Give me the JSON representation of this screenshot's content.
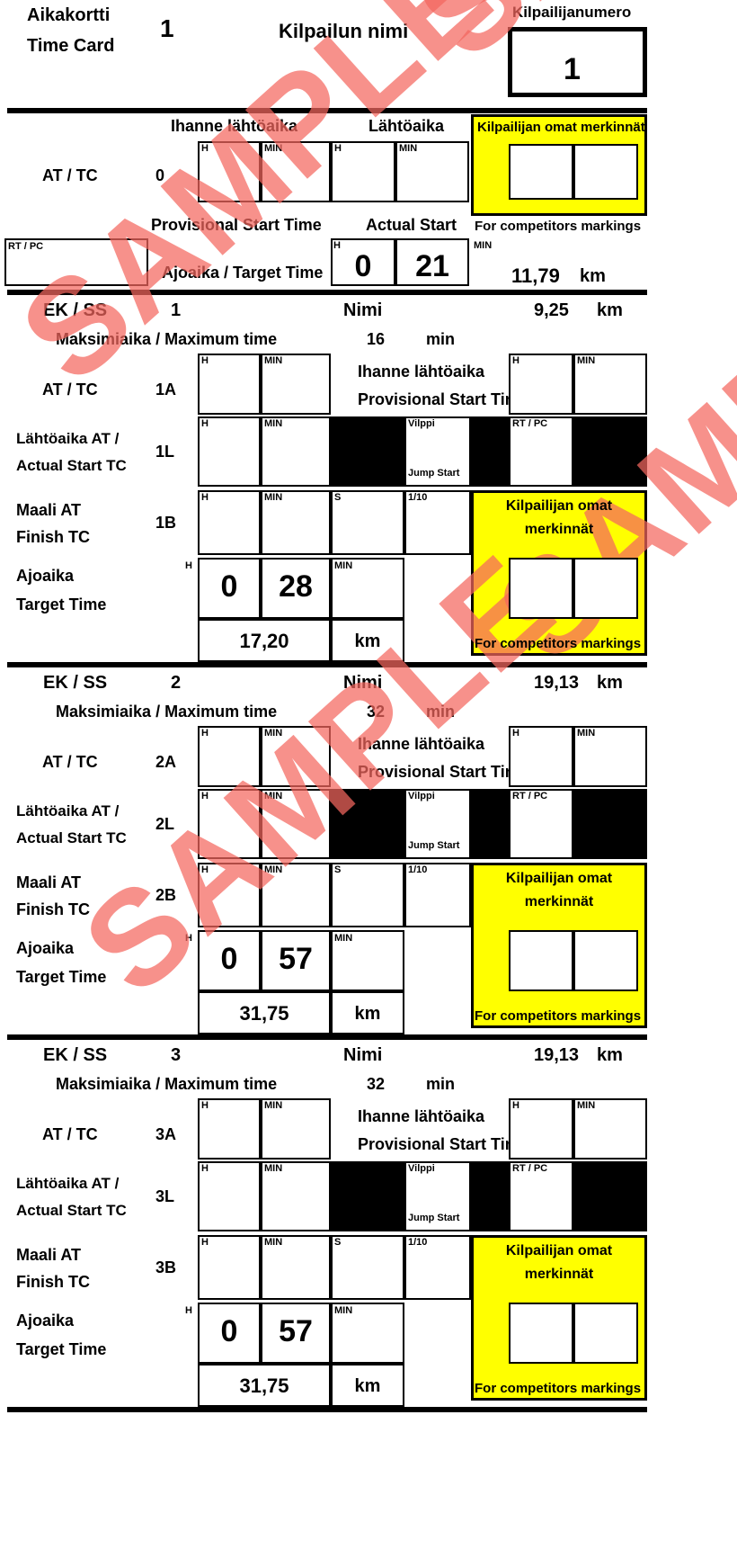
{
  "document": {
    "title_fi": "Aikakortti",
    "title_en": "Time Card",
    "card_number": "1",
    "event_name_label": "Kilpailun nimi",
    "competitor_number_label": "Kilpailijanumero",
    "competitor_number": "1",
    "watermark": "SAMPLE"
  },
  "labels": {
    "at_tc": "AT / TC",
    "ihanne_lahtoaika": "Ihanne lähtöaika",
    "provisional_start_time": "Provisional Start Time",
    "lahtoaika": "Lähtöaika",
    "actual_start": "Actual Start",
    "kilpailijan_omat_merkinnat": "Kilpailijan omat merkinnät",
    "kilpailijan_omat": "Kilpailijan omat",
    "merkinnat": "merkinnät",
    "for_competitors_markings": "For competitors markings",
    "rt_pc": "RT / PC",
    "ajoaika_target_time": "Ajoaika / Target Time",
    "ajoaika": "Ajoaika",
    "target_time": "Target Time",
    "ek_ss": "EK / SS",
    "nimi": "Nimi",
    "maksimiaika": "Maksimiaika / Maximum time",
    "min": "min",
    "km": "km",
    "h": "H",
    "minute": "MIN",
    "s": "S",
    "tenth": "1/10",
    "vilppi": "Vilppi",
    "jump_start": "Jump Start",
    "lahtoaika_at": "Lähtöaika AT /",
    "actual_start_tc": "Actual Start TC",
    "maali_at": "Maali AT",
    "finish_tc": "Finish TC"
  },
  "header_section": {
    "at_tc_code": "0",
    "target_time_h": "0",
    "target_time_min": "21",
    "distance": "11,79",
    "distance_unit": "km"
  },
  "stages": [
    {
      "number": "1",
      "stage_distance": "9,25",
      "stage_distance_unit": "km",
      "max_time": "16",
      "max_time_unit": "min",
      "at_code": "1A",
      "start_code": "1L",
      "finish_code": "1B",
      "target_time_h": "0",
      "target_time_min": "28",
      "road_distance": "17,20",
      "road_distance_unit": "km"
    },
    {
      "number": "2",
      "stage_distance": "19,13",
      "stage_distance_unit": "km",
      "max_time": "32",
      "max_time_unit": "min",
      "at_code": "2A",
      "start_code": "2L",
      "finish_code": "2B",
      "target_time_h": "0",
      "target_time_min": "57",
      "road_distance": "31,75",
      "road_distance_unit": "km"
    },
    {
      "number": "3",
      "stage_distance": "19,13",
      "stage_distance_unit": "km",
      "max_time": "32",
      "max_time_unit": "min",
      "at_code": "3A",
      "start_code": "3L",
      "finish_code": "3B",
      "target_time_h": "0",
      "target_time_min": "57",
      "road_distance": "31,75",
      "road_distance_unit": "km"
    }
  ],
  "colors": {
    "highlight_yellow": "#ffff00",
    "watermark_red": "#f4675f",
    "ink_black": "#000000"
  }
}
